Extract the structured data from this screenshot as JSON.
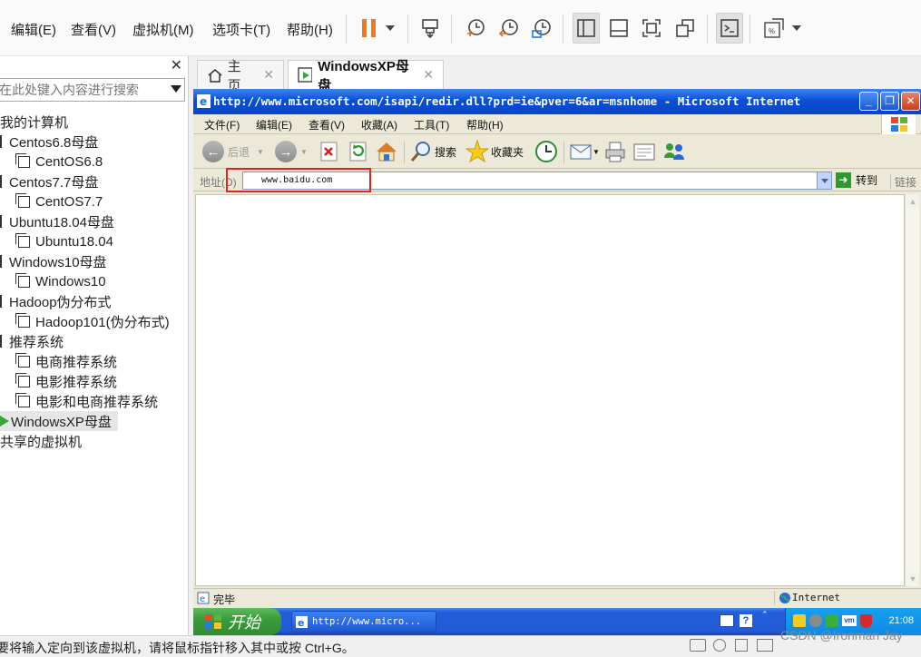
{
  "menubar": {
    "items": [
      "编辑(E)",
      "查看(V)",
      "虚拟机(M)",
      "选项卡(T)",
      "帮助(H)"
    ]
  },
  "toolbar": {
    "icons": [
      "pause-icon",
      "send-keys-icon",
      "snapshot-take-icon",
      "snapshot-revert-icon",
      "snapshot-manager-icon",
      "library-view-icon",
      "thumbnail-icon",
      "fullscreen-icon",
      "unity-icon",
      "console-icon",
      "stretch-icon"
    ]
  },
  "library": {
    "search_placeholder": "在此处键入内容进行搜索",
    "tree": [
      {
        "label": "我的计算机",
        "indent": 0,
        "icon": "none"
      },
      {
        "label": "Centos6.8母盘",
        "indent": 1,
        "icon": "pin"
      },
      {
        "label": "CentOS6.8",
        "indent": 2,
        "icon": "vm"
      },
      {
        "label": "Centos7.7母盘",
        "indent": 1,
        "icon": "pin"
      },
      {
        "label": "CentOS7.7",
        "indent": 2,
        "icon": "vm"
      },
      {
        "label": "Ubuntu18.04母盘",
        "indent": 1,
        "icon": "pin"
      },
      {
        "label": "Ubuntu18.04",
        "indent": 2,
        "icon": "vm"
      },
      {
        "label": "Windows10母盘",
        "indent": 1,
        "icon": "pin"
      },
      {
        "label": "Windows10",
        "indent": 2,
        "icon": "vm"
      },
      {
        "label": "Hadoop伪分布式",
        "indent": 1,
        "icon": "pin"
      },
      {
        "label": "Hadoop101(伪分布式)",
        "indent": 2,
        "icon": "vm"
      },
      {
        "label": "推荐系统",
        "indent": 1,
        "icon": "pin"
      },
      {
        "label": "电商推荐系统",
        "indent": 2,
        "icon": "vm"
      },
      {
        "label": "电影推荐系统",
        "indent": 2,
        "icon": "vm"
      },
      {
        "label": "电影和电商推荐系统",
        "indent": 2,
        "icon": "vm"
      },
      {
        "label": "WindowsXP母盘",
        "indent": 1,
        "icon": "play",
        "selected": true
      },
      {
        "label": "共享的虚拟机",
        "indent": 0,
        "icon": "none"
      }
    ]
  },
  "tabs": [
    {
      "label": "主页",
      "icon": "home-icon"
    },
    {
      "label": "WindowsXP母盘",
      "icon": "vm-running-icon",
      "active": true
    }
  ],
  "guest": {
    "title": "http://www.microsoft.com/isapi/redir.dll?prd=ie&pver=6&ar=msnhome - Microsoft Internet",
    "menu": [
      "文件(F)",
      "编辑(E)",
      "查看(V)",
      "收藏(A)",
      "工具(T)",
      "帮助(H)"
    ],
    "toolbar": {
      "back": "后退",
      "search": "搜索",
      "favorites": "收藏夹"
    },
    "address": {
      "label": "地址(D)",
      "value": "www.baidu.com",
      "go": "转到",
      "links": "链接"
    },
    "status": {
      "text": "完毕",
      "zone": "Internet"
    },
    "taskbar": {
      "start": "开始",
      "task": "http://www.micro...",
      "clock": "21:08"
    }
  },
  "vm_status": {
    "text": "要将输入定向到该虚拟机，请将鼠标指针移入其中或按 Ctrl+G。"
  },
  "watermark": "CSDN @Ironman Jay",
  "colors": {
    "xp_blue": "#0a4fd6",
    "highlight_red": "#e02424",
    "pause_orange": "#f07a1a"
  }
}
